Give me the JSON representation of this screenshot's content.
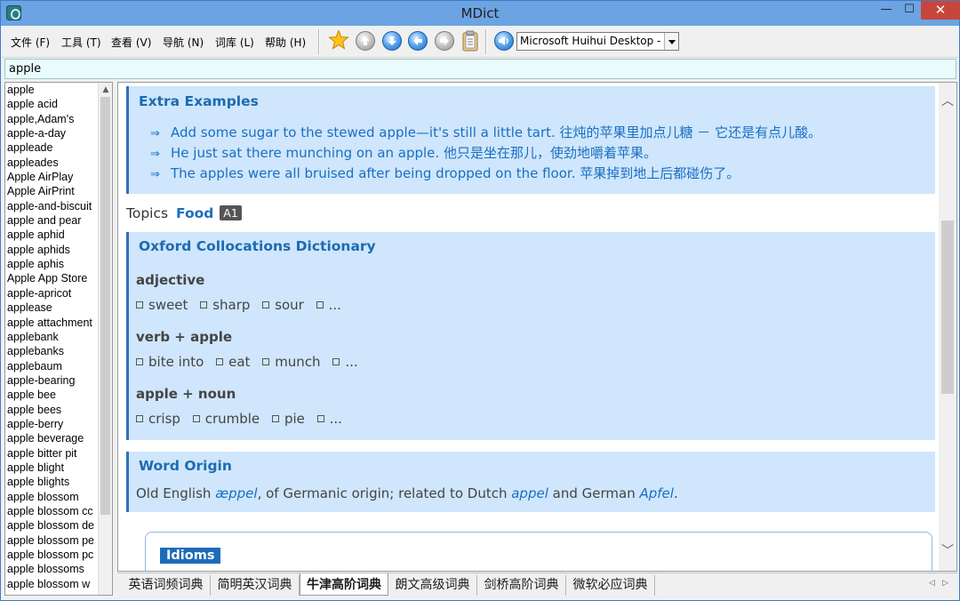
{
  "window": {
    "title": "MDict",
    "minimize_glyph": "—",
    "maximize_glyph": "☐",
    "close_glyph": "✕"
  },
  "menu": [
    {
      "label": "文件 (F)"
    },
    {
      "label": "工具 (T)"
    },
    {
      "label": "查看 (V)"
    },
    {
      "label": "导航 (N)"
    },
    {
      "label": "词库 (L)"
    },
    {
      "label": "帮助 (H)"
    }
  ],
  "toolbar": {
    "icons": [
      "favorite-star-icon",
      "back-icon",
      "forward-icon",
      "previous-icon",
      "next-icon",
      "clipboard-icon",
      "speaker-icon"
    ],
    "voice_select": "Microsoft Huihui Desktop - C"
  },
  "search": {
    "value": "apple"
  },
  "word_list": [
    "apple",
    "apple acid",
    "apple,Adam's",
    "apple-a-day",
    "appleade",
    "appleades",
    "Apple AirPlay",
    "Apple AirPrint",
    "apple-and-biscuit",
    "apple and pear",
    "apple aphid",
    "apple aphids",
    "apple aphis",
    "Apple App Store",
    "apple-apricot",
    "applease",
    "apple attachment",
    "applebank",
    "applebanks",
    "applebaum",
    "apple-bearing",
    "apple bee",
    "apple bees",
    "apple-berry",
    "apple beverage",
    "apple bitter pit",
    "apple blight",
    "apple blights",
    "apple blossom",
    "apple blossom cc",
    "apple blossom de",
    "apple blossom pe",
    "apple blossom pc",
    "apple blossoms",
    "apple blossom w"
  ],
  "extra_examples": {
    "title": "Extra Examples",
    "arrow": "⇒",
    "items": [
      "Add some sugar to the stewed apple—it's still a little tart. 往炖的苹果里加点儿糖 － 它还是有点儿酸。",
      "He just sat there munching on an apple. 他只是坐在那儿，使劲地嚼着苹果。",
      "The apples were all bruised after being dropped on the floor. 苹果掉到地上后都碰伤了。"
    ]
  },
  "topics": {
    "label": "Topics",
    "topic": "Food",
    "level": "A1"
  },
  "collocations": {
    "title": "Oxford Collocations Dictionary",
    "groups": [
      {
        "heading": "adjective",
        "words": [
          "sweet",
          "sharp",
          "sour",
          "..."
        ]
      },
      {
        "heading": "verb + apple",
        "words": [
          "bite into",
          "eat",
          "munch",
          "..."
        ]
      },
      {
        "heading": "apple + noun",
        "words": [
          "crisp",
          "crumble",
          "pie",
          "..."
        ]
      }
    ]
  },
  "word_origin": {
    "title": "Word Origin",
    "text_1": "Old English ",
    "ital_1": "æppel",
    "text_2": ", of Germanic origin; related to Dutch ",
    "ital_2": "appel",
    "text_3": " and German ",
    "ital_3": "Apfel",
    "text_4": "."
  },
  "idioms": {
    "label": "Idioms"
  },
  "tabs": [
    {
      "label": "英语词频词典",
      "active": false
    },
    {
      "label": "简明英汉词典",
      "active": false
    },
    {
      "label": "牛津高阶词典",
      "active": true
    },
    {
      "label": "朗文高级词典",
      "active": false
    },
    {
      "label": "剑桥高阶词典",
      "active": false
    },
    {
      "label": "微软必应词典",
      "active": false
    }
  ],
  "colors": {
    "accent": "#1a6fc2",
    "panel_bg": "#cfe6fc",
    "panel_border": "#2f72b8",
    "titlebar": "#6ca3e2",
    "close": "#c7463b"
  }
}
